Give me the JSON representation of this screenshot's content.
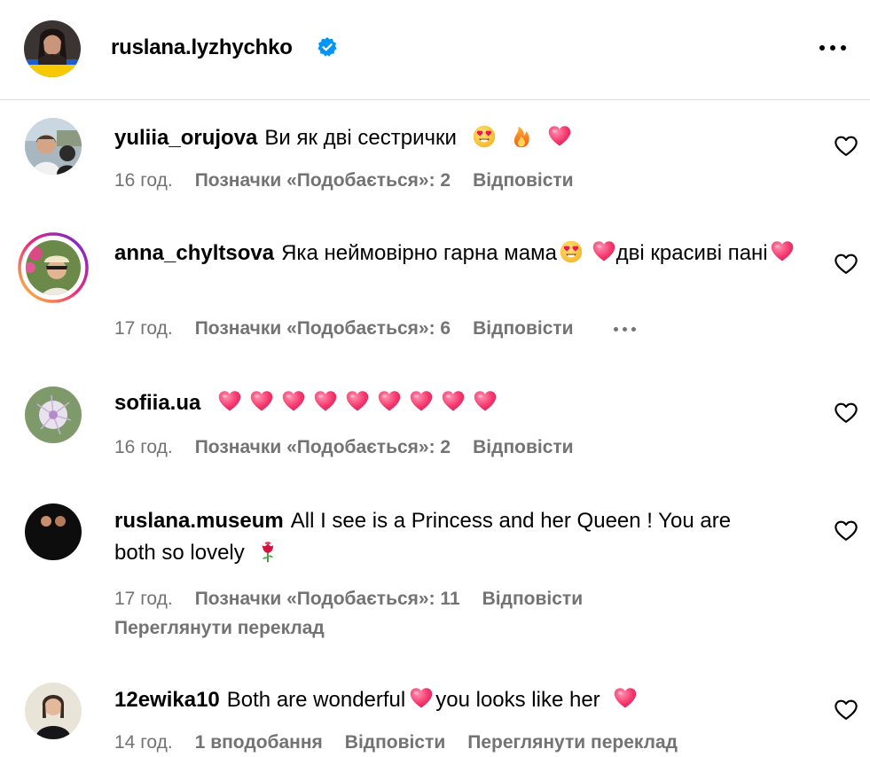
{
  "post": {
    "username": "ruslana.lyzhychko",
    "verified_icon": "verified-badge-icon",
    "more_icon": "more-horizontal-icon"
  },
  "comments": [
    {
      "username": "yuliia_orujova",
      "text": "Ви як дві сестрички",
      "emojis": [
        "smiling-face-heart-eyes",
        "fire",
        "pink-heart"
      ],
      "time": "16 год.",
      "likes": "Позначки «Подобається»: 2",
      "reply": "Відповісти"
    },
    {
      "username": "anna_chyltsova",
      "text_part1": "Яка неймовірно гарна мама",
      "text_part2": "дві красиві пані",
      "emojis": [
        "smiling-face-heart-eyes",
        "pink-heart",
        "pink-heart"
      ],
      "time": "17 год.",
      "likes": "Позначки «Подобається»: 6",
      "reply": "Відповісти"
    },
    {
      "username": "sofiia.ua",
      "emojis": [
        "pink-heart",
        "pink-heart",
        "pink-heart",
        "pink-heart",
        "pink-heart",
        "pink-heart",
        "pink-heart",
        "pink-heart",
        "pink-heart"
      ],
      "time": "16 год.",
      "likes": "Позначки «Подобається»: 2",
      "reply": "Відповісти"
    },
    {
      "username": "ruslana.museum",
      "text_part1": "All I see is a Princess and her Queen ! You are",
      "text_part2": "both so lovely",
      "emojis": [
        "rose"
      ],
      "time": "17 год.",
      "likes": "Позначки «Подобається»: 11",
      "reply": "Відповісти",
      "translate": "Переглянути переклад"
    },
    {
      "username": "12ewika10",
      "text_part1": "Both are wonderful",
      "text_part2": "you looks like her",
      "emojis": [
        "pink-heart",
        "pink-heart"
      ],
      "time": "14 год.",
      "likes": "1 вподобання",
      "reply": "Відповісти",
      "translate": "Переглянути переклад"
    }
  ],
  "colors": {
    "text": "#000000",
    "meta": "#737373",
    "divider": "#dbdbdb",
    "verified": "#0095f6",
    "heart": "#ff3b6b",
    "story_ring_start": "#f9ce34",
    "story_ring_end": "#ee2a7b"
  }
}
